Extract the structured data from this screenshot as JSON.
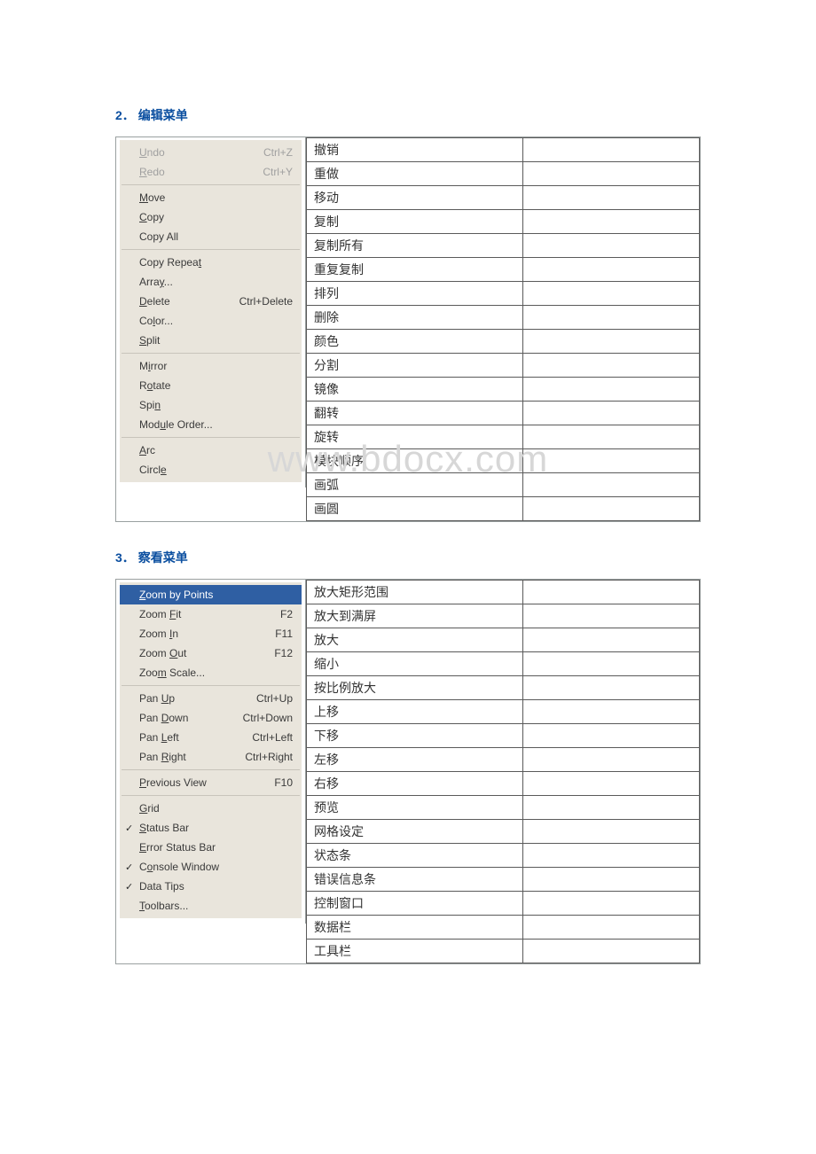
{
  "watermark": "www.bdocx.com",
  "sections": [
    {
      "num": "2．",
      "title": "编辑菜单",
      "menu": [
        {
          "type": "group",
          "items": [
            {
              "labelParts": [
                {
                  "u": "U"
                },
                {
                  "t": "ndo"
                }
              ],
              "shortcut": "Ctrl+Z",
              "disabled": true
            },
            {
              "labelParts": [
                {
                  "u": "R"
                },
                {
                  "t": "edo"
                }
              ],
              "shortcut": "Ctrl+Y",
              "disabled": true
            }
          ]
        },
        {
          "type": "sep"
        },
        {
          "type": "group",
          "items": [
            {
              "labelParts": [
                {
                  "u": "M"
                },
                {
                  "t": "ove"
                }
              ]
            },
            {
              "labelParts": [
                {
                  "u": "C"
                },
                {
                  "t": "opy"
                }
              ]
            },
            {
              "labelParts": [
                {
                  "t": "Copy All"
                }
              ]
            }
          ]
        },
        {
          "type": "sep"
        },
        {
          "type": "group",
          "items": [
            {
              "labelParts": [
                {
                  "t": "Copy Repea"
                },
                {
                  "u": "t"
                }
              ]
            },
            {
              "labelParts": [
                {
                  "t": "Arra"
                },
                {
                  "u": "y"
                },
                {
                  "t": "..."
                }
              ]
            },
            {
              "labelParts": [
                {
                  "u": "D"
                },
                {
                  "t": "elete"
                }
              ],
              "shortcut": "Ctrl+Delete"
            },
            {
              "labelParts": [
                {
                  "t": "Co"
                },
                {
                  "u": "l"
                },
                {
                  "t": "or..."
                }
              ]
            },
            {
              "labelParts": [
                {
                  "u": "S"
                },
                {
                  "t": "plit"
                }
              ]
            }
          ]
        },
        {
          "type": "sep"
        },
        {
          "type": "group",
          "items": [
            {
              "labelParts": [
                {
                  "t": "M"
                },
                {
                  "u": "i"
                },
                {
                  "t": "rror"
                }
              ]
            },
            {
              "labelParts": [
                {
                  "t": "R"
                },
                {
                  "u": "o"
                },
                {
                  "t": "tate"
                }
              ]
            },
            {
              "labelParts": [
                {
                  "t": "Spi"
                },
                {
                  "u": "n"
                }
              ]
            },
            {
              "labelParts": [
                {
                  "t": "Mod"
                },
                {
                  "u": "u"
                },
                {
                  "t": "le Order..."
                }
              ]
            }
          ]
        },
        {
          "type": "sep"
        },
        {
          "type": "group",
          "items": [
            {
              "labelParts": [
                {
                  "u": "A"
                },
                {
                  "t": "rc"
                }
              ]
            },
            {
              "labelParts": [
                {
                  "t": "Circl"
                },
                {
                  "u": "e"
                }
              ]
            }
          ]
        }
      ],
      "translations": [
        "撤销",
        "重做",
        "移动",
        "复制",
        "复制所有",
        "重复复制",
        "排列",
        "删除",
        "颜色",
        "分割",
        "镜像",
        "翻转",
        "旋转",
        "模块顺序",
        "画弧",
        "画圆"
      ]
    },
    {
      "num": "3．",
      "title": "察看菜单",
      "watermarkTop": 612,
      "menu": [
        {
          "type": "group",
          "items": [
            {
              "labelParts": [
                {
                  "u": "Z"
                },
                {
                  "t": "oom by Points"
                }
              ],
              "selected": true
            },
            {
              "labelParts": [
                {
                  "t": "Zoom "
                },
                {
                  "u": "F"
                },
                {
                  "t": "it"
                }
              ],
              "shortcut": "F2"
            },
            {
              "labelParts": [
                {
                  "t": "Zoom "
                },
                {
                  "u": "I"
                },
                {
                  "t": "n"
                }
              ],
              "shortcut": "F11"
            },
            {
              "labelParts": [
                {
                  "t": "Zoom "
                },
                {
                  "u": "O"
                },
                {
                  "t": "ut"
                }
              ],
              "shortcut": "F12"
            },
            {
              "labelParts": [
                {
                  "t": "Zoo"
                },
                {
                  "u": "m"
                },
                {
                  "t": " Scale..."
                }
              ]
            }
          ]
        },
        {
          "type": "sep"
        },
        {
          "type": "group",
          "items": [
            {
              "labelParts": [
                {
                  "t": "Pan "
                },
                {
                  "u": "U"
                },
                {
                  "t": "p"
                }
              ],
              "shortcut": "Ctrl+Up"
            },
            {
              "labelParts": [
                {
                  "t": "Pan "
                },
                {
                  "u": "D"
                },
                {
                  "t": "own"
                }
              ],
              "shortcut": "Ctrl+Down"
            },
            {
              "labelParts": [
                {
                  "t": "Pan "
                },
                {
                  "u": "L"
                },
                {
                  "t": "eft"
                }
              ],
              "shortcut": "Ctrl+Left"
            },
            {
              "labelParts": [
                {
                  "t": "Pan "
                },
                {
                  "u": "R"
                },
                {
                  "t": "ight"
                }
              ],
              "shortcut": "Ctrl+Right"
            }
          ]
        },
        {
          "type": "sep"
        },
        {
          "type": "group",
          "items": [
            {
              "labelParts": [
                {
                  "u": "P"
                },
                {
                  "t": "revious View"
                }
              ],
              "shortcut": "F10"
            }
          ]
        },
        {
          "type": "sep"
        },
        {
          "type": "group",
          "items": [
            {
              "labelParts": [
                {
                  "u": "G"
                },
                {
                  "t": "rid"
                }
              ]
            },
            {
              "labelParts": [
                {
                  "u": "S"
                },
                {
                  "t": "tatus Bar"
                }
              ],
              "checked": true
            },
            {
              "labelParts": [
                {
                  "u": "E"
                },
                {
                  "t": "rror Status Bar"
                }
              ]
            },
            {
              "labelParts": [
                {
                  "t": "C"
                },
                {
                  "u": "o"
                },
                {
                  "t": "nsole Window"
                }
              ],
              "checked": true
            },
            {
              "labelParts": [
                {
                  "t": "Data Tips"
                }
              ],
              "checked": true
            },
            {
              "labelParts": [
                {
                  "u": "T"
                },
                {
                  "t": "oolbars..."
                }
              ]
            }
          ]
        }
      ],
      "translations": [
        "放大矩形范围",
        "放大到满屏",
        "放大",
        "缩小",
        "按比例放大",
        "上移",
        "下移",
        "左移",
        "右移",
        "预览",
        "网格设定",
        "状态条",
        "错误信息条",
        "控制窗口",
        "数据栏",
        "工具栏"
      ]
    }
  ]
}
